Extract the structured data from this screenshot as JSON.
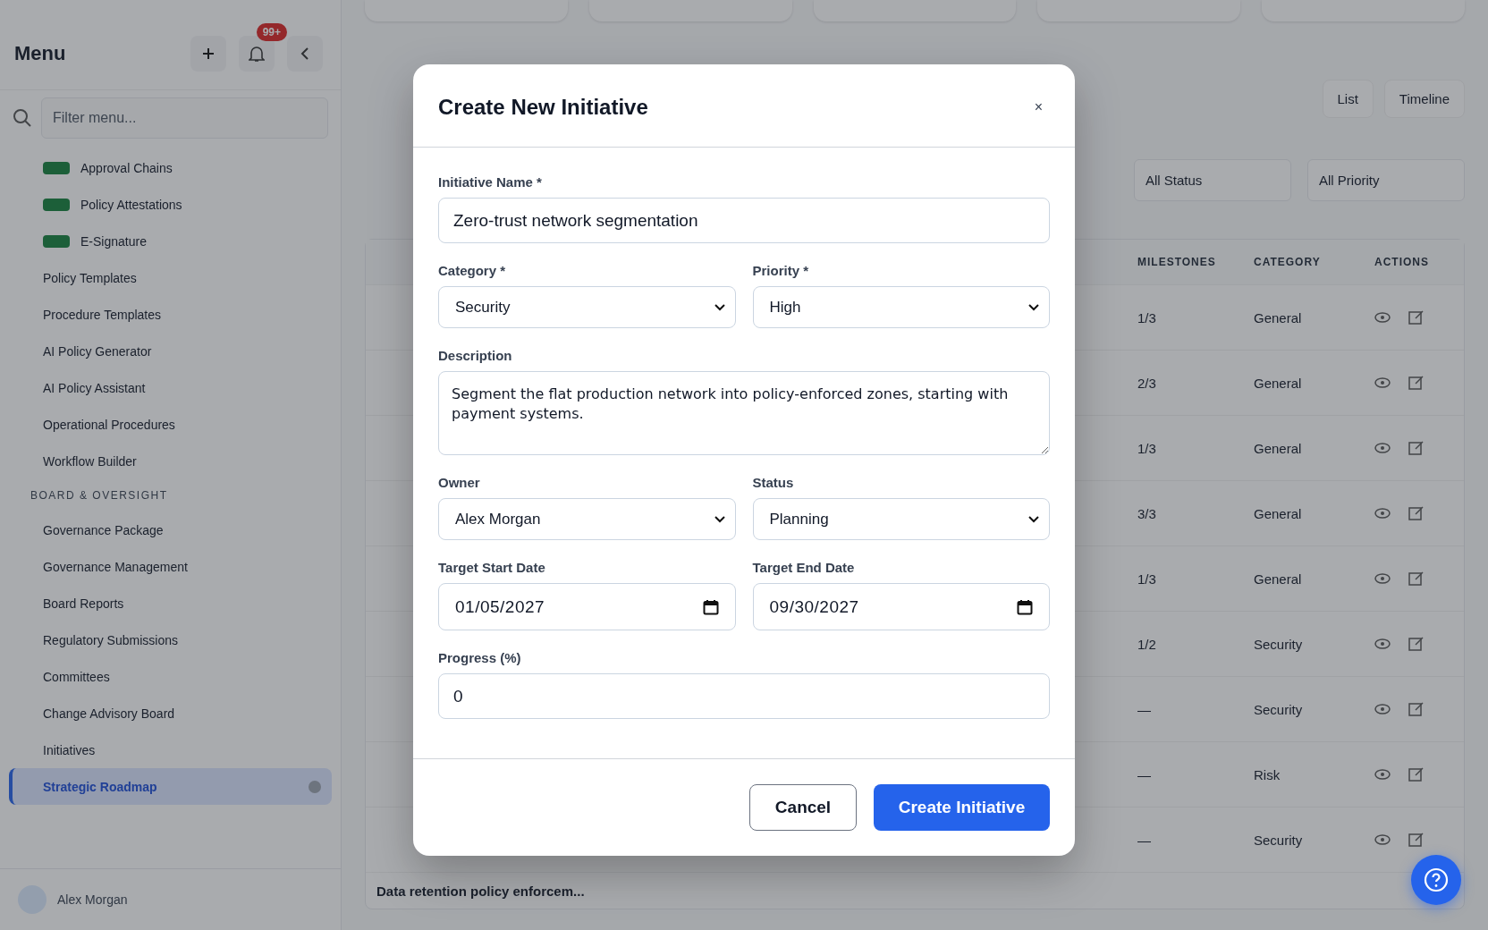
{
  "sidebar": {
    "title": "Menu",
    "notification_badge": "99+",
    "filter": {
      "placeholder": "Filter menu..."
    },
    "items": [
      {
        "kind": "badged",
        "label": "Approval Chains",
        "selected": false
      },
      {
        "kind": "badged",
        "label": "Policy Attestations",
        "selected": false
      },
      {
        "kind": "badged",
        "label": "E-Signature",
        "selected": false
      },
      {
        "kind": "link",
        "label": "Policy Templates",
        "selected": false
      },
      {
        "kind": "link",
        "label": "Procedure Templates",
        "selected": false
      },
      {
        "kind": "link",
        "label": "AI Policy Generator",
        "selected": false
      },
      {
        "kind": "link",
        "label": "AI Policy Assistant",
        "selected": false
      },
      {
        "kind": "link",
        "label": "Operational Procedures",
        "selected": false
      },
      {
        "kind": "link",
        "label": "Workflow Builder",
        "selected": false
      },
      {
        "kind": "section",
        "label": "BOARD & OVERSIGHT",
        "selected": false
      },
      {
        "kind": "link",
        "label": "Governance Package",
        "selected": false
      },
      {
        "kind": "link",
        "label": "Governance Management",
        "selected": false
      },
      {
        "kind": "link",
        "label": "Board Reports",
        "selected": false
      },
      {
        "kind": "link",
        "label": "Regulatory Submissions",
        "selected": false
      },
      {
        "kind": "link",
        "label": "Committees",
        "selected": false
      },
      {
        "kind": "link",
        "label": "Change Advisory Board",
        "selected": false
      },
      {
        "kind": "link",
        "label": "Initiatives",
        "selected": false
      },
      {
        "kind": "link",
        "label": "Strategic Roadmap",
        "selected": true
      }
    ],
    "user": {
      "name": "Alex Morgan"
    }
  },
  "main": {
    "view_buttons": [
      {
        "label": "List"
      },
      {
        "label": "Timeline"
      }
    ],
    "filters": [
      {
        "value": "All Status"
      },
      {
        "value": "All Priority"
      }
    ],
    "columns": [
      "MILESTONES",
      "CATEGORY",
      "ACTIONS"
    ],
    "rows": [
      {
        "milestones": "1/3",
        "category": "General"
      },
      {
        "milestones": "2/3",
        "category": "General"
      },
      {
        "milestones": "1/3",
        "category": "General"
      },
      {
        "milestones": "3/3",
        "category": "General"
      },
      {
        "milestones": "1/3",
        "category": "General"
      },
      {
        "milestones": "1/2",
        "category": "Security"
      },
      {
        "milestones": "—",
        "category": "Security"
      },
      {
        "milestones": "—",
        "category": "Risk"
      },
      {
        "milestones": "—",
        "category": "Security"
      }
    ],
    "last_row": {
      "title": "Data retention policy enforcem..."
    }
  },
  "modal": {
    "title": "Create New Initiative",
    "close": "×",
    "fields": [
      {
        "kind": "text",
        "label": "Initiative Name *",
        "value": "Zero-trust network segmentation"
      },
      {
        "kind": "select",
        "label": "Category *",
        "value": "Security"
      },
      {
        "kind": "select",
        "label": "Priority *",
        "value": "High"
      },
      {
        "kind": "textarea",
        "label": "Description",
        "value": "Segment the flat production network into policy-enforced zones, starting with payment systems."
      },
      {
        "kind": "select",
        "label": "Owner",
        "value": "Alex Morgan"
      },
      {
        "kind": "select",
        "label": "Status",
        "value": "Planning"
      },
      {
        "kind": "date",
        "label": "Target Start Date",
        "value": "01/05/2027"
      },
      {
        "kind": "date",
        "label": "Target End Date",
        "value": "09/30/2027"
      },
      {
        "kind": "number",
        "label": "Progress (%)",
        "value": "0"
      }
    ],
    "buttons": [
      {
        "kind": "secondary",
        "label": "Cancel"
      },
      {
        "kind": "primary",
        "label": "Create Initiative"
      }
    ]
  }
}
